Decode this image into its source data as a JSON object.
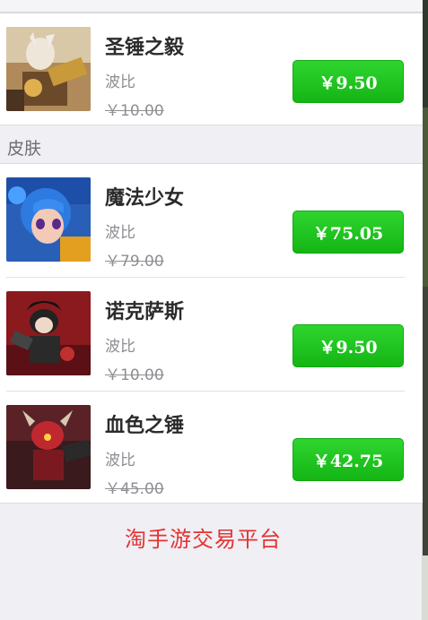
{
  "sections": [
    {
      "header": "",
      "items": [
        {
          "name": "圣锤之毅",
          "seller": "波比",
          "original_price": "￥10.00",
          "price_label": "￥9.50",
          "thumbnail": "poppy-hammer-skin-icon"
        }
      ]
    },
    {
      "header": "皮肤",
      "items": [
        {
          "name": "魔法少女",
          "seller": "波比",
          "original_price": "￥79.00",
          "price_label": "￥75.05",
          "thumbnail": "poppy-star-guardian-icon"
        },
        {
          "name": "诺克萨斯",
          "seller": "波比",
          "original_price": "￥10.00",
          "price_label": "￥9.50",
          "thumbnail": "poppy-noxus-icon"
        },
        {
          "name": "血色之锤",
          "seller": "波比",
          "original_price": "￥45.00",
          "price_label": "￥42.75",
          "thumbnail": "poppy-blood-hammer-icon"
        }
      ]
    }
  ],
  "watermark": "淘手游交易平台",
  "colors": {
    "buy_button": "#1cc21c",
    "watermark": "#e53333",
    "background": "#efeff4"
  }
}
